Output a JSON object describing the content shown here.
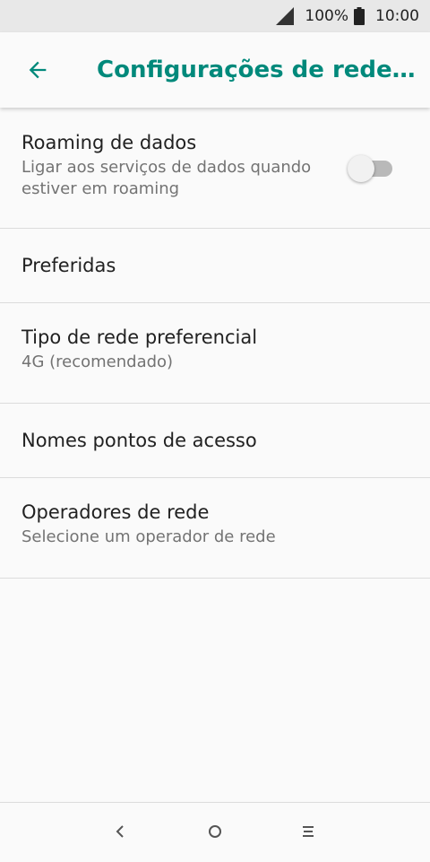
{
  "status_bar": {
    "battery_percent": "100%",
    "time": "10:00",
    "icons": [
      "signal-icon",
      "battery-icon"
    ]
  },
  "app_bar": {
    "back_icon": "arrow-back-icon",
    "title": "Configurações de rede…"
  },
  "settings": {
    "roaming": {
      "label": "Roaming de dados",
      "summary": "Ligar aos serviços de dados quando estiver em roaming",
      "enabled": false
    },
    "preferred": {
      "label": "Preferidas"
    },
    "network_type": {
      "label": "Tipo de rede preferencial",
      "summary": "4G (recomendado)"
    },
    "apn": {
      "label": "Nomes pontos de acesso"
    },
    "operators": {
      "label": "Operadores de rede",
      "summary": "Selecione um operador de rede"
    }
  },
  "nav_bar": {
    "icons": [
      "back-nav-icon",
      "home-nav-icon",
      "menu-nav-icon"
    ]
  },
  "colors": {
    "accent": "#00897b",
    "background": "#fafafa",
    "status_bar": "#e8e8e8",
    "divider": "#dcdcdc"
  }
}
